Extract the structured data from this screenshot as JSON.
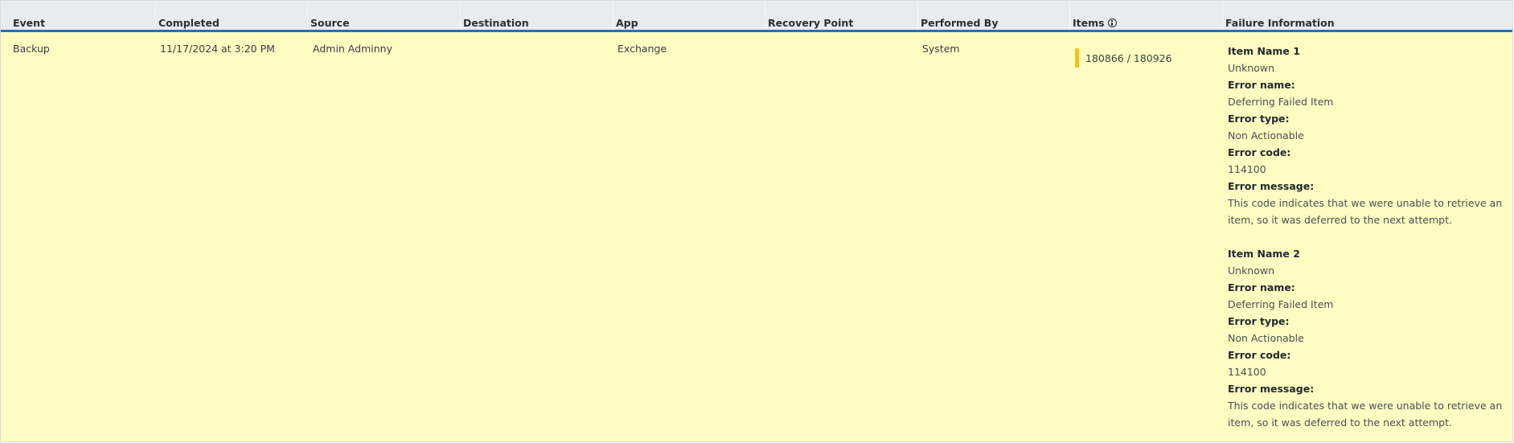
{
  "columns": [
    "Event",
    "Completed",
    "Source",
    "Destination",
    "App",
    "Recovery Point",
    "Performed By",
    "Items",
    "Failure Information"
  ],
  "row": {
    "event": "Backup",
    "completed": "11/17/2024 at 3:20 PM",
    "source": "Admin Adminny",
    "destination": "",
    "app": "Exchange",
    "recovery_point": "",
    "performed_by": "System",
    "items": "180866 / 180926",
    "items_color": "#f2c418",
    "failures": [
      {
        "title": "Item Name 1",
        "status": "Unknown",
        "error_name_label": "Error name:",
        "error_name": "Deferring Failed Item",
        "error_type_label": "Error type:",
        "error_type": "Non Actionable",
        "error_code_label": "Error code:",
        "error_code": "114100",
        "error_message_label": "Error message:",
        "error_message": "This code indicates that we were unable to retrieve an item, so it was deferred to the next attempt."
      },
      {
        "title": "Item Name 2",
        "status": "Unknown",
        "error_name_label": "Error name:",
        "error_name": "Deferring Failed Item",
        "error_type_label": "Error type:",
        "error_type": "Non Actionable",
        "error_code_label": "Error code:",
        "error_code": "114100",
        "error_message_label": "Error message:",
        "error_message": "This code indicates that we were unable to retrieve an item, so it was deferred to the next attempt."
      }
    ]
  },
  "icons": {
    "items_info": "info-icon"
  },
  "colors": {
    "header_bg": "#e9ebee",
    "header_border": "#1f72c2",
    "row_bg": "#fffcc2"
  }
}
